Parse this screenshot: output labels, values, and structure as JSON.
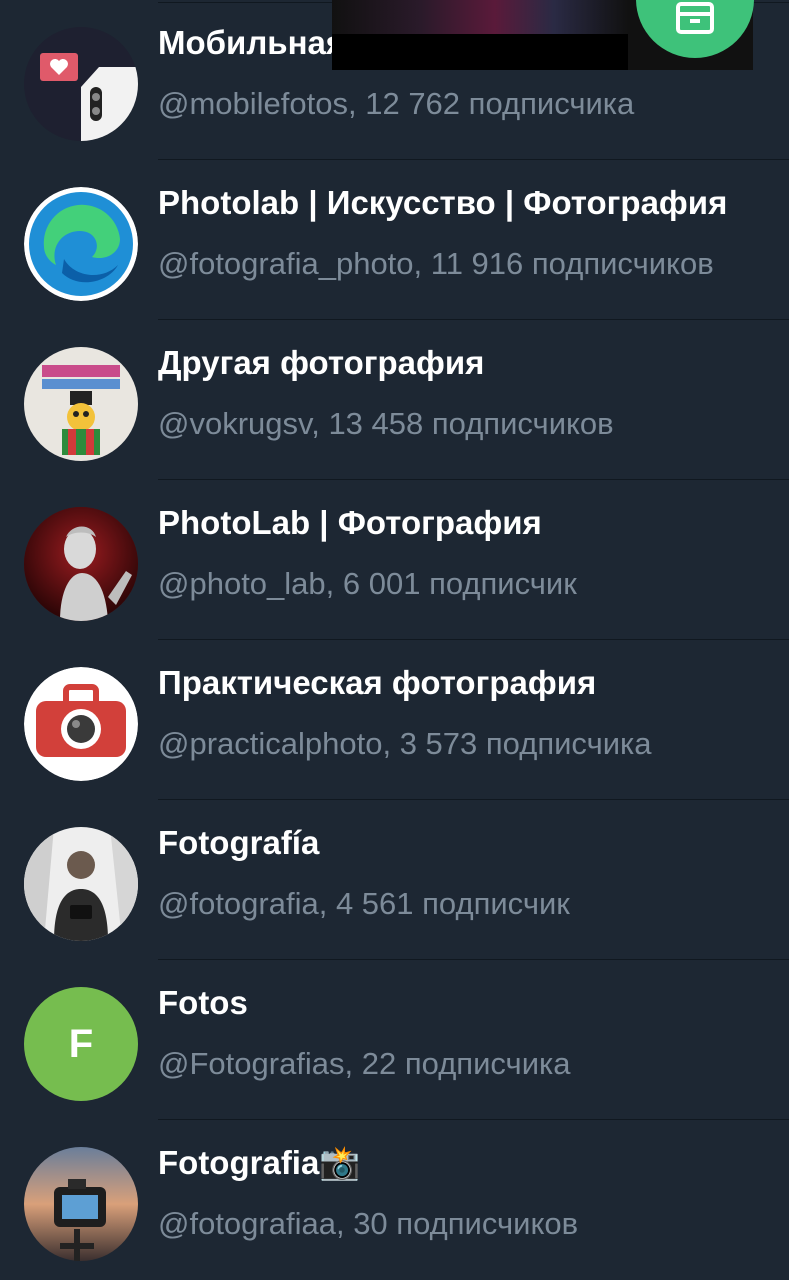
{
  "channels": [
    {
      "name": "Мобильная фотография",
      "sub": "@mobilefotos, 12 762 подписчика",
      "avatar": "phone-heart"
    },
    {
      "name": "Photolab | Искусство | Фотография",
      "sub": "@fotografia_photo, 11 916 подписчиков",
      "avatar": "edge-logo"
    },
    {
      "name": "Другая фотография",
      "sub": "@vokrugsv, 13 458 подписчиков",
      "avatar": "cartoon-bird"
    },
    {
      "name": "PhotoLab | Фотография",
      "sub": "@photo_lab, 6 001 подписчик",
      "avatar": "statue"
    },
    {
      "name": "Практическая фотография",
      "sub": "@practicalphoto, 3 573 подписчика",
      "avatar": "camera"
    },
    {
      "name": "Fotografía",
      "sub": "@fotografia, 4 561 подписчик",
      "avatar": "photographer"
    },
    {
      "name": "Fotos",
      "sub": "@Fotografias, 22 подписчика",
      "avatar": "letter",
      "letter": "F",
      "color": "#76bd4f"
    },
    {
      "name": "Fotografia📸",
      "sub": "@fotografiaa, 30 подписчиков",
      "avatar": "camera-sunset"
    }
  ],
  "colors": {
    "background": "#1d2733",
    "subtext": "#7d8b99",
    "fab": "#3ec27a"
  }
}
